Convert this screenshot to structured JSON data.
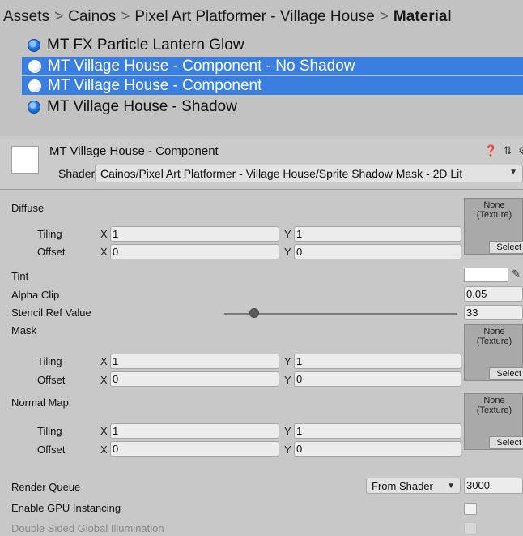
{
  "breadcrumb": {
    "items": [
      "Assets",
      "Cainos",
      "Pixel Art Platformer - Village House",
      "Material"
    ],
    "separator": ">"
  },
  "assets": [
    {
      "name": "MT FX Particle Lantern Glow",
      "selected": false,
      "icon": "material-sphere-icon"
    },
    {
      "name": "MT Village House - Component - No Shadow",
      "selected": true,
      "icon": "material-sphere-icon"
    },
    {
      "name": "MT Village House - Component",
      "selected": true,
      "icon": "material-sphere-icon"
    },
    {
      "name": "MT Village House - Shadow",
      "selected": false,
      "icon": "material-sphere-icon"
    }
  ],
  "inspector": {
    "title": "MT Village House - Component",
    "header_icons": "❓ ⇅ ⚙",
    "shader_label": "Shader",
    "shader_value": "Cainos/Pixel Art Platformer - Village House/Sprite Shadow Mask - 2D Lit",
    "texture_slot": {
      "none": "None",
      "type": "(Texture)",
      "select": "Select"
    },
    "diffuse": {
      "label": "Diffuse",
      "tiling_label": "Tiling",
      "tiling_x": "1",
      "tiling_y": "1",
      "offset_label": "Offset",
      "offset_x": "0",
      "offset_y": "0"
    },
    "tint_label": "Tint",
    "alpha_clip": {
      "label": "Alpha Clip",
      "value": "0.05"
    },
    "stencil": {
      "label": "Stencil Ref Value",
      "value": "33",
      "slider_fraction": 0.13
    },
    "mask": {
      "label": "Mask",
      "tiling_label": "Tiling",
      "tiling_x": "1",
      "tiling_y": "1",
      "offset_label": "Offset",
      "offset_x": "0",
      "offset_y": "0"
    },
    "normal_map": {
      "label": "Normal Map",
      "tiling_label": "Tiling",
      "tiling_x": "1",
      "tiling_y": "1",
      "offset_label": "Offset",
      "offset_x": "0",
      "offset_y": "0"
    },
    "axis_x": "X",
    "axis_y": "Y",
    "render_queue": {
      "label": "Render Queue",
      "mode": "From Shader",
      "value": "3000"
    },
    "gpu_instancing": {
      "label": "Enable GPU Instancing",
      "checked": false
    },
    "double_sided_gi": {
      "label": "Double Sided Global Illumination",
      "checked": false,
      "enabled": false
    }
  },
  "colors": {
    "selection": "#3a7fe0",
    "panel": "#c8c8c8"
  }
}
